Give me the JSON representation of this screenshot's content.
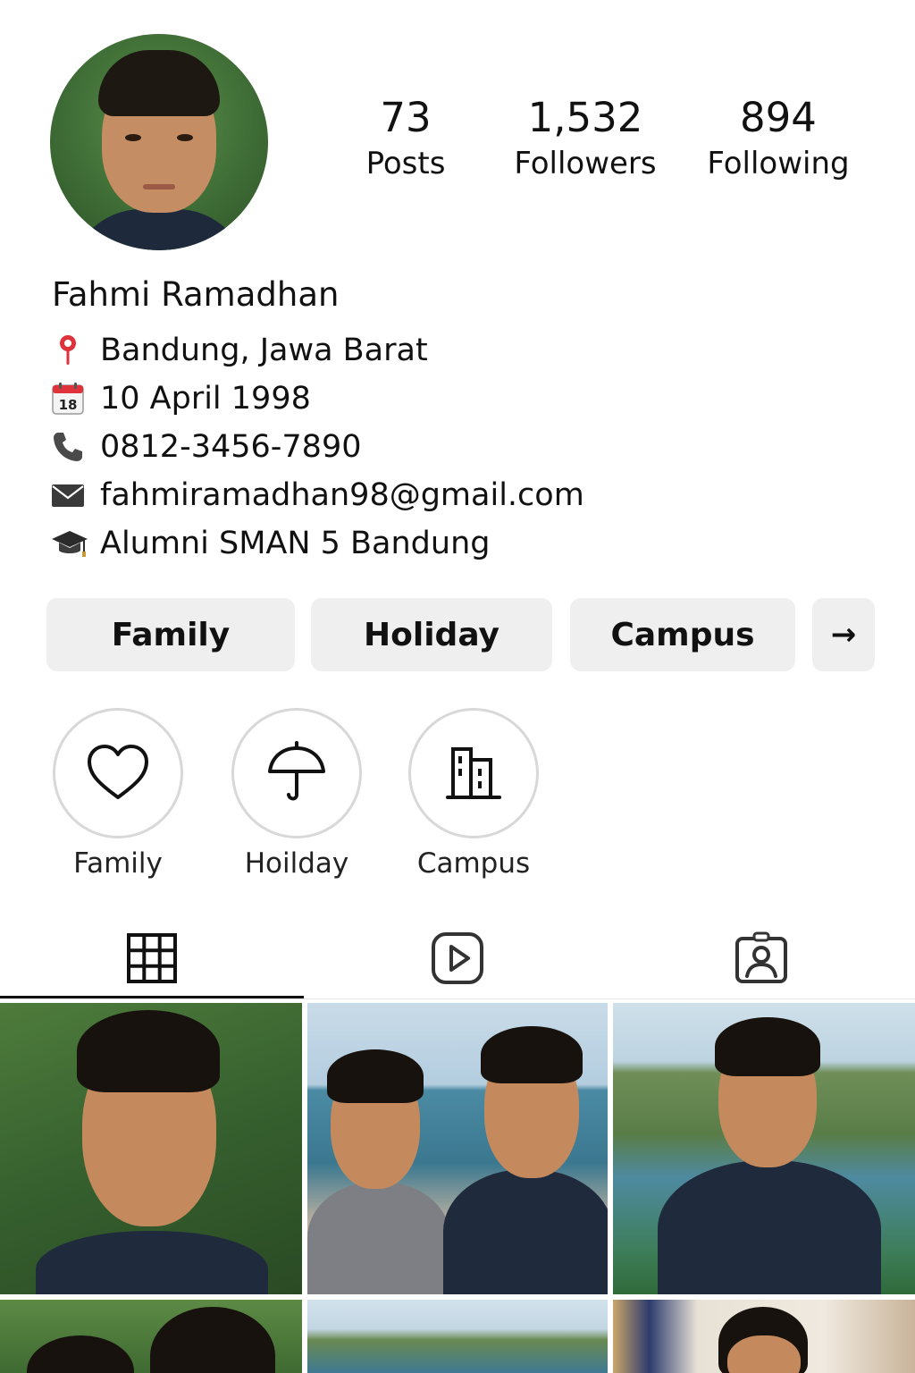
{
  "profile": {
    "name": "Fahmi Ramadhan",
    "avatar_alt": "profile photo"
  },
  "stats": {
    "posts": {
      "value": "73",
      "label": "Posts"
    },
    "followers": {
      "value": "1,532",
      "label": "Followers"
    },
    "following": {
      "value": "894",
      "label": "Following"
    }
  },
  "bio": {
    "location": {
      "icon": "location-pin-icon",
      "text": "Bandung, Jawa Barat"
    },
    "birthday": {
      "icon": "calendar-icon",
      "calendar_day": "18",
      "text": "10 April 1998"
    },
    "phone": {
      "icon": "phone-icon",
      "text": "0812-3456-7890"
    },
    "email": {
      "icon": "envelope-icon",
      "text": "fahmiramadhan98@gmail.com"
    },
    "education": {
      "icon": "graduation-cap-icon",
      "text": "Alumni SMAN 5 Bandung"
    }
  },
  "pills": {
    "family": "Family",
    "holiday": "Holiday",
    "campus": "Campus",
    "more": "→"
  },
  "highlights": [
    {
      "label": "Family",
      "icon": "heart-icon"
    },
    {
      "label": "Hoilday",
      "icon": "umbrella-icon"
    },
    {
      "label": "Campus",
      "icon": "building-icon"
    }
  ],
  "tabs": {
    "grid": "grid-icon",
    "reels": "play-icon",
    "tagged": "tagged-person-icon",
    "active": "grid"
  },
  "colors": {
    "accent": "#111111",
    "pill_bg": "#efefef",
    "ring": "#d8d8d8",
    "pin": "#e0323a"
  }
}
